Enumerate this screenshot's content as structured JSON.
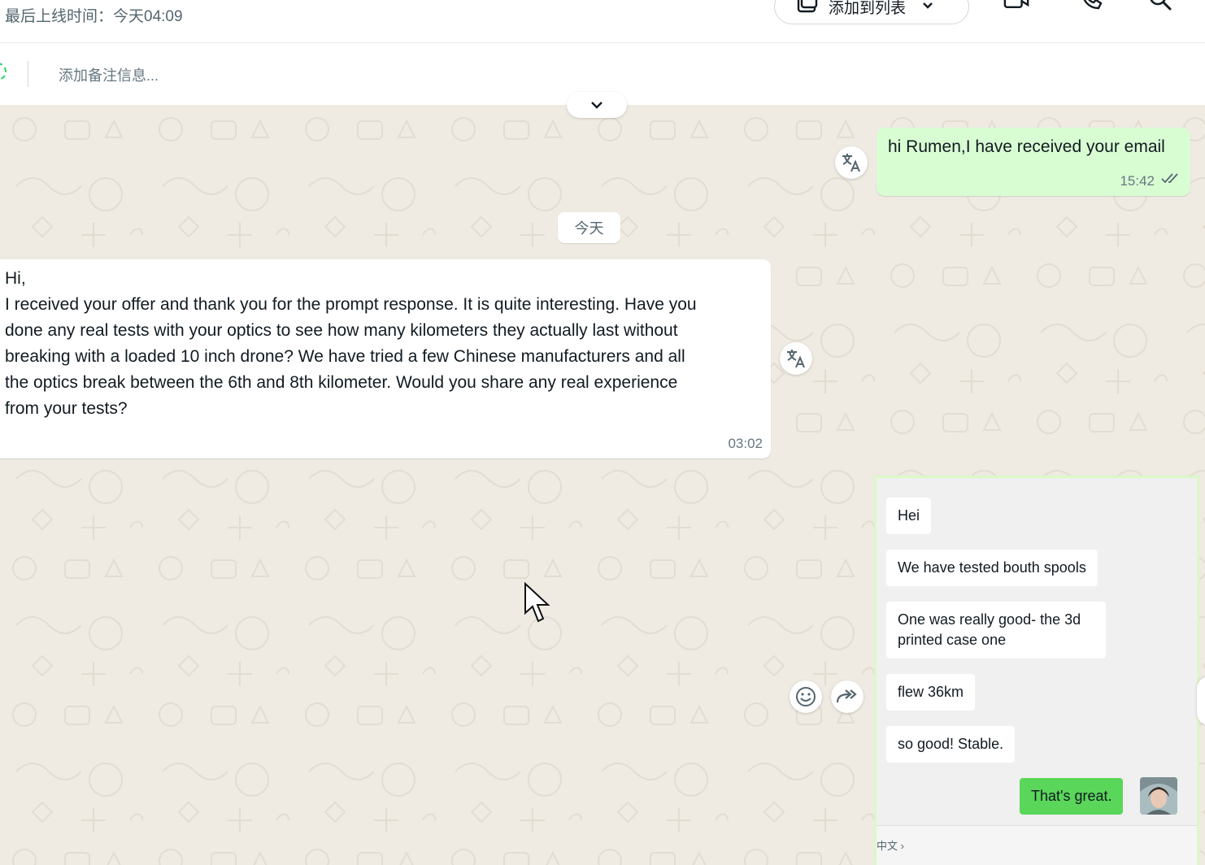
{
  "header": {
    "last_seen": "最后上线时间：今天04:09",
    "add_to_list_label": "添加到列表",
    "icons": [
      "list-add-icon",
      "chevron-down-icon",
      "video-call-icon",
      "voice-call-icon",
      "search-icon"
    ]
  },
  "note": {
    "placeholder": "添加备注信息..."
  },
  "chat": {
    "outgoing_message": {
      "text": "hi Rumen,I have received your email",
      "time": "15:42",
      "status": "read"
    },
    "date_divider": "今天",
    "incoming_message": {
      "lines": [
        "Hi,",
        "I received your offer and thank you for the prompt response. It is quite interesting. Have you",
        "done any real tests with your optics to see how many kilometers they actually last without",
        "breaking with a loaded 10 inch drone? We have tried a few Chinese manufacturers and all",
        "the optics break between the 6th and 8th kilometer. Would you share any real experience",
        "from your tests?"
      ],
      "time": "03:02"
    },
    "card_preview": {
      "messages": [
        {
          "text": "Hei",
          "from": "other"
        },
        {
          "text": "We have tested bouth spools",
          "from": "other"
        },
        {
          "text_lines": [
            "One was really good- the 3d",
            "printed case one"
          ],
          "from": "other"
        },
        {
          "text": "flew 36km",
          "from": "other"
        },
        {
          "text": "so good! Stable.",
          "from": "other"
        },
        {
          "text": "That's great.",
          "from": "me"
        }
      ],
      "footer_lang": "中文 ›"
    }
  },
  "colors": {
    "outgoing_bubble": "#d9fdd3",
    "incoming_bubble": "#ffffff",
    "chat_background": "#efeae2",
    "accent_green": "#5ad65a"
  }
}
